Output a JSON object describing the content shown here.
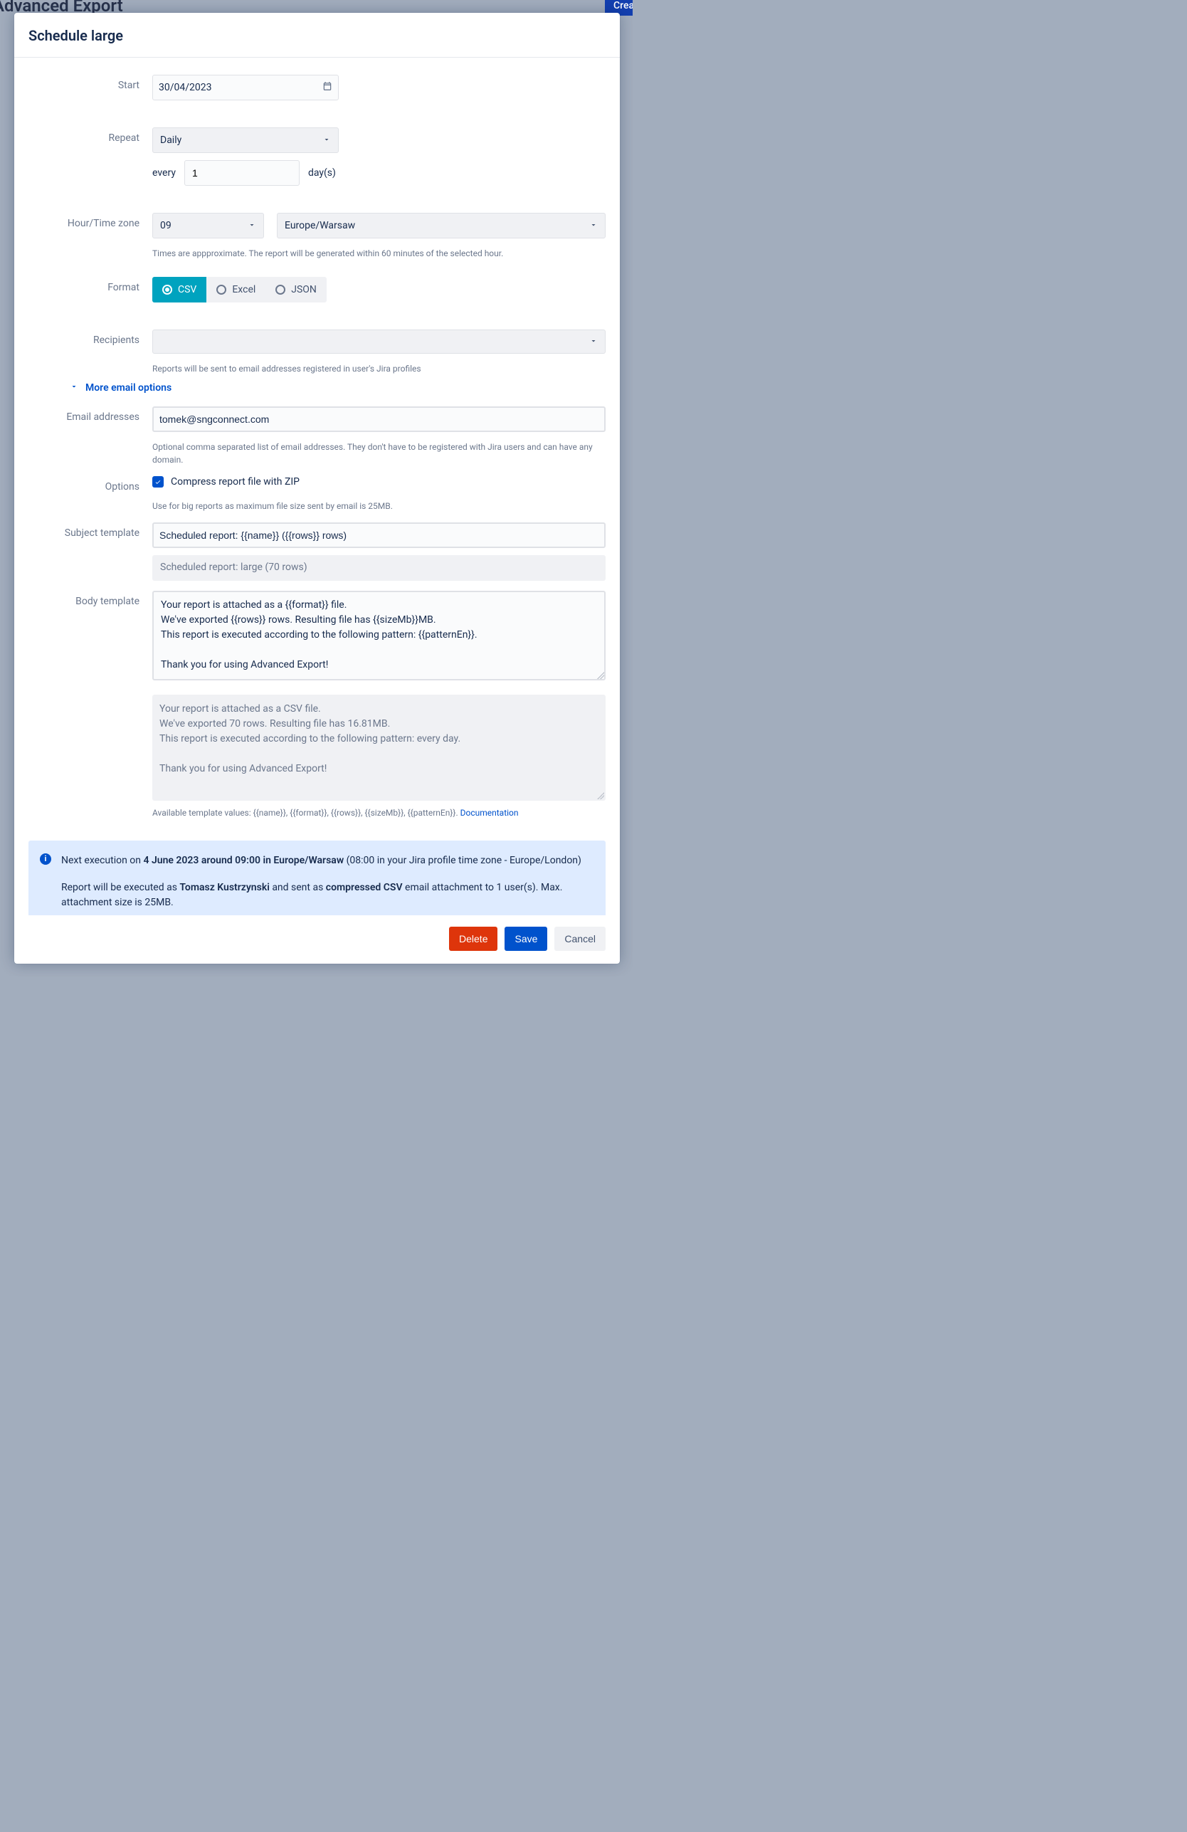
{
  "background": {
    "title": "Advanced Export",
    "create": "Crea"
  },
  "modal": {
    "title": "Schedule large"
  },
  "labels": {
    "start": "Start",
    "repeat": "Repeat",
    "every": "every",
    "days": "day(s)",
    "hour": "Hour/Time zone",
    "format": "Format",
    "recipients": "Recipients",
    "more_email": "More email options",
    "email_addresses": "Email addresses",
    "options": "Options",
    "subject_template": "Subject template",
    "body_template": "Body template"
  },
  "start": {
    "value": "30/04/2023"
  },
  "repeat": {
    "value": "Daily",
    "every_value": "1"
  },
  "hour": {
    "value": "09",
    "tz": "Europe/Warsaw",
    "help": "Times are appproximate. The report will be generated within 60 minutes of the selected hour."
  },
  "format": {
    "options": [
      "CSV",
      "Excel",
      "JSON"
    ],
    "selected": "CSV"
  },
  "recipients": {
    "help": "Reports will be sent to email addresses registered in user's Jira profiles"
  },
  "email": {
    "value": "tomek@sngconnect.com",
    "help": "Optional comma separated list of email addresses. They don't have to be registered with Jira users and can have any domain."
  },
  "options": {
    "zip_label": "Compress report file with ZIP",
    "zip_help": "Use for big reports as maximum file size sent by email is 25MB.",
    "zip_checked": true
  },
  "subject": {
    "value": "Scheduled report: {{name}} ({{rows}} rows)",
    "preview": "Scheduled report: large (70 rows)"
  },
  "body": {
    "value": "Your report is attached as a {{format}} file.\nWe've exported {{rows}} rows. Resulting file has {{sizeMb}}MB.\nThis report is executed according to the following pattern: {{patternEn}}.\n\nThank you for using Advanced Export!",
    "preview": "Your report is attached as a CSV file.\nWe've exported 70 rows. Resulting file has 16.81MB.\nThis report is executed according to the following pattern: every day.\n\nThank you for using Advanced Export!",
    "footnote_prefix": "Available template values: {{name}}, {{format}}, {{rows}}, {{sizeMb}}, {{patternEn}}. ",
    "doc_link": "Documentation"
  },
  "info": {
    "line1_pre": "Next execution on ",
    "line1_bold": "4 June 2023 around 09:00 in Europe/Warsaw",
    "line1_post": " (08:00 in your Jira profile time zone - Europe/London)",
    "line2_pre": "Report will be executed as ",
    "line2_bold1": "Tomasz Kustrzynski",
    "line2_mid": " and sent as ",
    "line2_bold2": "compressed CSV",
    "line2_post": " email attachment to 1 user(s). Max. attachment size is 25MB."
  },
  "buttons": {
    "delete": "Delete",
    "save": "Save",
    "cancel": "Cancel"
  }
}
